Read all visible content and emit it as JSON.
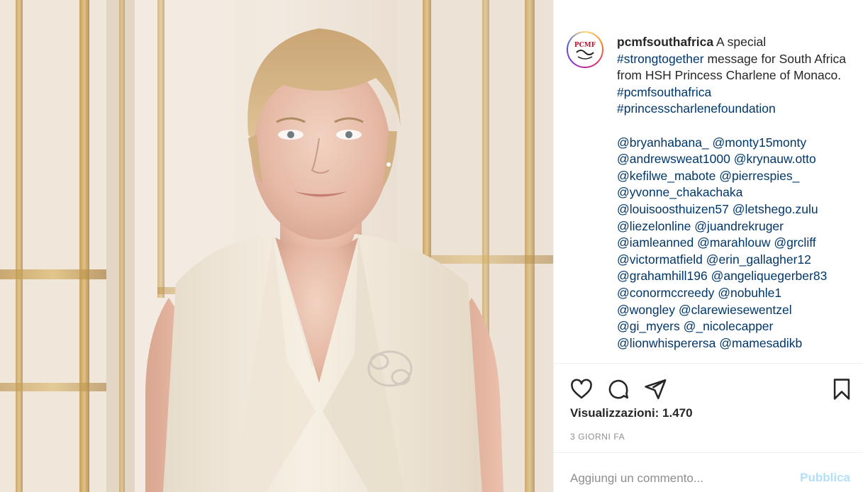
{
  "post": {
    "username": "pcmfsouthafrica",
    "avatar_alt": "PCMF logo",
    "caption_text": "A special",
    "caption_parts": [
      {
        "text": " ",
        "type": "text"
      },
      {
        "text": "#strongtogether",
        "type": "tag"
      },
      {
        "text": " message for South Africa from HSH Princess Charlene of Monaco.",
        "type": "text"
      }
    ],
    "hashtags": [
      "#pcmfsouthafrica",
      "#princesscharlenefoundation"
    ],
    "mention_lines": [
      [
        "@bryanhabana_",
        "@monty15monty"
      ],
      [
        "@andrewsweat1000",
        "@krynauw.otto"
      ],
      [
        "@kefilwe_mabote",
        "@pierrespies_"
      ],
      [
        "@yvonne_chakachaka"
      ],
      [
        "@louisoosthuizen57",
        "@letshego.zulu"
      ],
      [
        "@liezelonline",
        "@juandrekruger"
      ],
      [
        "@iamleanned",
        "@marahlouw",
        "@grcliff"
      ],
      [
        "@victormatfield",
        "@erin_gallagher12"
      ],
      [
        "@grahamhill196",
        "@angeliquegerber83"
      ],
      [
        "@conormccreedy",
        "@nobuhle1"
      ],
      [
        "@wongley",
        "@clarewiesewentzel"
      ],
      [
        "@gi_myers",
        "@_nicolecapper"
      ],
      [
        "@lionwhisperersa",
        "@mamesadikb"
      ]
    ]
  },
  "actions": {
    "like_icon": "heart-icon",
    "comment_icon": "comment-bubble-icon",
    "share_icon": "paper-plane-icon",
    "save_icon": "bookmark-icon"
  },
  "stats": {
    "views": "Visualizzazioni: 1.470",
    "date": "3 GIORNI FA"
  },
  "comment": {
    "placeholder": "Aggiungi un commento...",
    "publish_label": "Pubblica"
  },
  "colors": {
    "link": "#00376b",
    "publish_disabled": "#b2dffc",
    "muted": "#8e8e8e"
  }
}
